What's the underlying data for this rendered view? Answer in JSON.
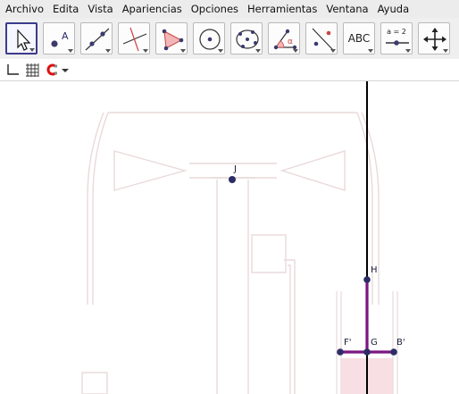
{
  "menu": {
    "items": [
      "Archivo",
      "Edita",
      "Vista",
      "Apariencias",
      "Opciones",
      "Herramientas",
      "Ventana",
      "Ayuda"
    ]
  },
  "toolbar": {
    "tools": [
      {
        "name": "move-tool",
        "icon": "arrow-cursor-icon",
        "selected": true
      },
      {
        "name": "new-point-tool",
        "icon": "point-a-icon",
        "text": "A"
      },
      {
        "name": "line-through-two-points-tool",
        "icon": "line-icon"
      },
      {
        "name": "perpendicular-line-tool",
        "icon": "perpendicular-icon"
      },
      {
        "name": "polygon-tool",
        "icon": "polygon-icon"
      },
      {
        "name": "circle-center-point-tool",
        "icon": "circle-icon"
      },
      {
        "name": "conic-five-points-tool",
        "icon": "conic-icon"
      },
      {
        "name": "angle-tool",
        "icon": "angle-icon",
        "text": "α"
      },
      {
        "name": "reflect-tool",
        "icon": "reflect-icon"
      },
      {
        "name": "insert-text-tool",
        "icon": "text-icon",
        "text": "ABC"
      },
      {
        "name": "slider-tool",
        "icon": "slider-icon",
        "text": "a = 2"
      },
      {
        "name": "move-graphics-view-tool",
        "icon": "move-view-icon"
      }
    ]
  },
  "stylebar": {
    "items": [
      "axes-icon",
      "grid-icon",
      "point-capture-icon",
      "dropdown-arrow-icon"
    ]
  },
  "canvas": {
    "points": [
      {
        "label": "J"
      },
      {
        "label": "H"
      },
      {
        "label": "F'"
      },
      {
        "label": "G"
      },
      {
        "label": "B'"
      }
    ],
    "colors": {
      "segment": "#7b1680",
      "point": "#2d2d66",
      "axis": "#000000",
      "figure": "#ead9da",
      "tank": "#f7dfe3"
    }
  }
}
